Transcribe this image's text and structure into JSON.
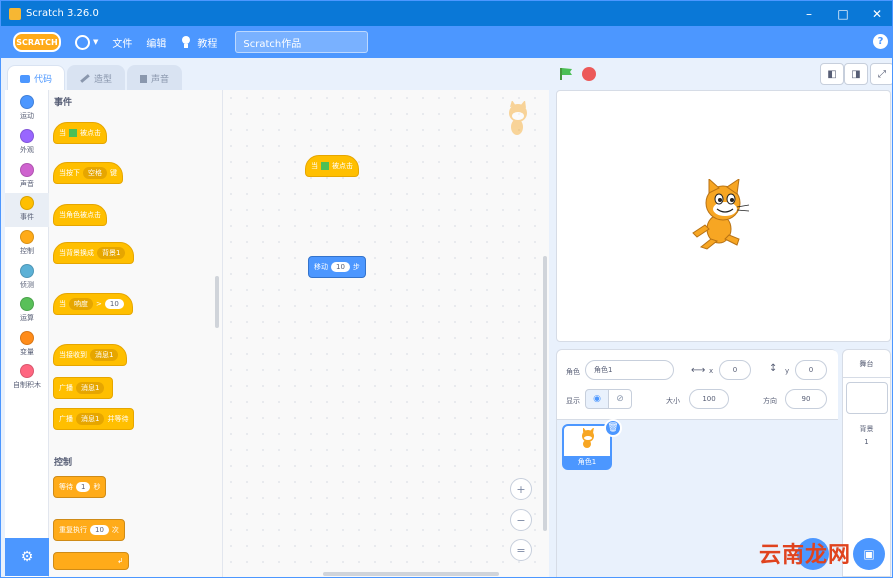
{
  "window": {
    "title": "Scratch 3.26.0",
    "min": "–",
    "max": "□",
    "close": "✕"
  },
  "menu": {
    "logo": "SCRATCH",
    "file": "文件",
    "edit": "编辑",
    "tutorials": "教程",
    "project_title": "Scratch作品",
    "help": "?"
  },
  "tabs": {
    "code": "代码",
    "costumes": "造型",
    "sounds": "声音"
  },
  "categories": [
    {
      "label": "运动",
      "color": "#4c97ff"
    },
    {
      "label": "外观",
      "color": "#9966ff"
    },
    {
      "label": "声音",
      "color": "#cf63cf"
    },
    {
      "label": "事件",
      "color": "#ffbf00"
    },
    {
      "label": "控制",
      "color": "#ffab19"
    },
    {
      "label": "侦测",
      "color": "#5cb1d6"
    },
    {
      "label": "运算",
      "color": "#59c059"
    },
    {
      "label": "变量",
      "color": "#ff8c1a"
    },
    {
      "label": "自制积木",
      "color": "#ff6680"
    }
  ],
  "palette": {
    "events_title": "事件",
    "when_flag_pre": "当",
    "when_flag_post": "被点击",
    "when_key_pre": "当按下",
    "when_key_dd": "空格",
    "when_key_post": "键",
    "when_sprite_clicked": "当角色被点击",
    "when_backdrop_pre": "当背景换成",
    "when_backdrop_dd": "背景1",
    "when_gt_pre": "当",
    "when_gt_dd": "响度",
    "when_gt_op": ">",
    "when_gt_val": "10",
    "when_receive_pre": "当接收到",
    "when_receive_dd": "消息1",
    "broadcast_pre": "广播",
    "broadcast_dd": "消息1",
    "broadcast_wait_pre": "广播",
    "broadcast_wait_dd": "消息1",
    "broadcast_wait_post": "并等待",
    "control_title": "控制",
    "wait_pre": "等待",
    "wait_val": "1",
    "wait_post": "秒",
    "repeat_pre": "重复执行",
    "repeat_val": "10",
    "repeat_post": "次"
  },
  "script": {
    "hat_pre": "当",
    "hat_post": "被点击",
    "move_pre": "移动",
    "move_val": "10",
    "move_post": "步"
  },
  "zoom": {
    "in": "+",
    "out": "−",
    "reset": "="
  },
  "sprite_info": {
    "sprite_label": "角色",
    "sprite_name": "角色1",
    "x_label": "x",
    "x_val": "0",
    "y_label": "y",
    "y_val": "0",
    "show_label": "显示",
    "size_label": "大小",
    "size_val": "100",
    "direction_label": "方向",
    "direction_val": "90"
  },
  "sprites": [
    {
      "name": "角色1"
    }
  ],
  "backdrop": {
    "title": "舞台",
    "label": "背景",
    "count": "1"
  },
  "watermark": "云南龙网"
}
